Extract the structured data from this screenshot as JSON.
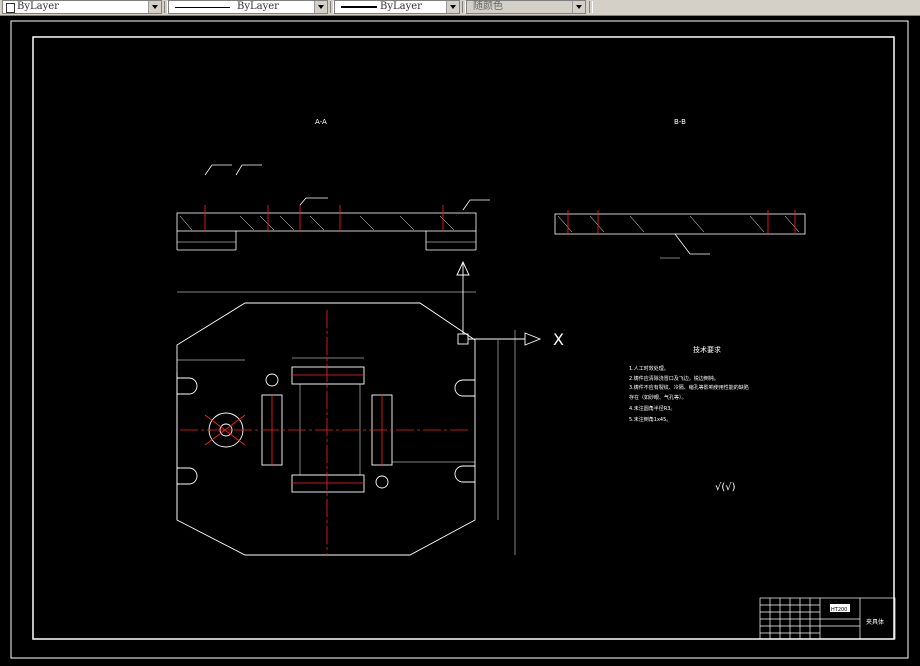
{
  "toolbar": {
    "layer_color": "ByLayer",
    "linetype": "ByLayer",
    "lineweight": "ByLayer",
    "plot_style": "随颜色"
  },
  "drawing": {
    "section_a_label": "A-A",
    "section_b_label": "B-B",
    "axis_x_label": "X",
    "notes_title": "技术要求",
    "notes": [
      "1.人工时效处理。",
      "2.铸件应清除浇冒口及飞边，锐边倒钝。",
      "3.铸件不应有裂纹、冷隔、缩孔等影响使用性能的缺陷",
      "   存在（如砂眼、气孔等）。",
      "4.未注圆角半径R3。",
      "5.未注倒角1x45。"
    ],
    "roughness_symbol": "√(√)",
    "title_block": {
      "material": "HT200",
      "part_name": "夹具体"
    }
  },
  "colors": {
    "background": "#000000",
    "line": "#ffffff",
    "center_line": "#ff2020",
    "accent": "#ffffff"
  }
}
